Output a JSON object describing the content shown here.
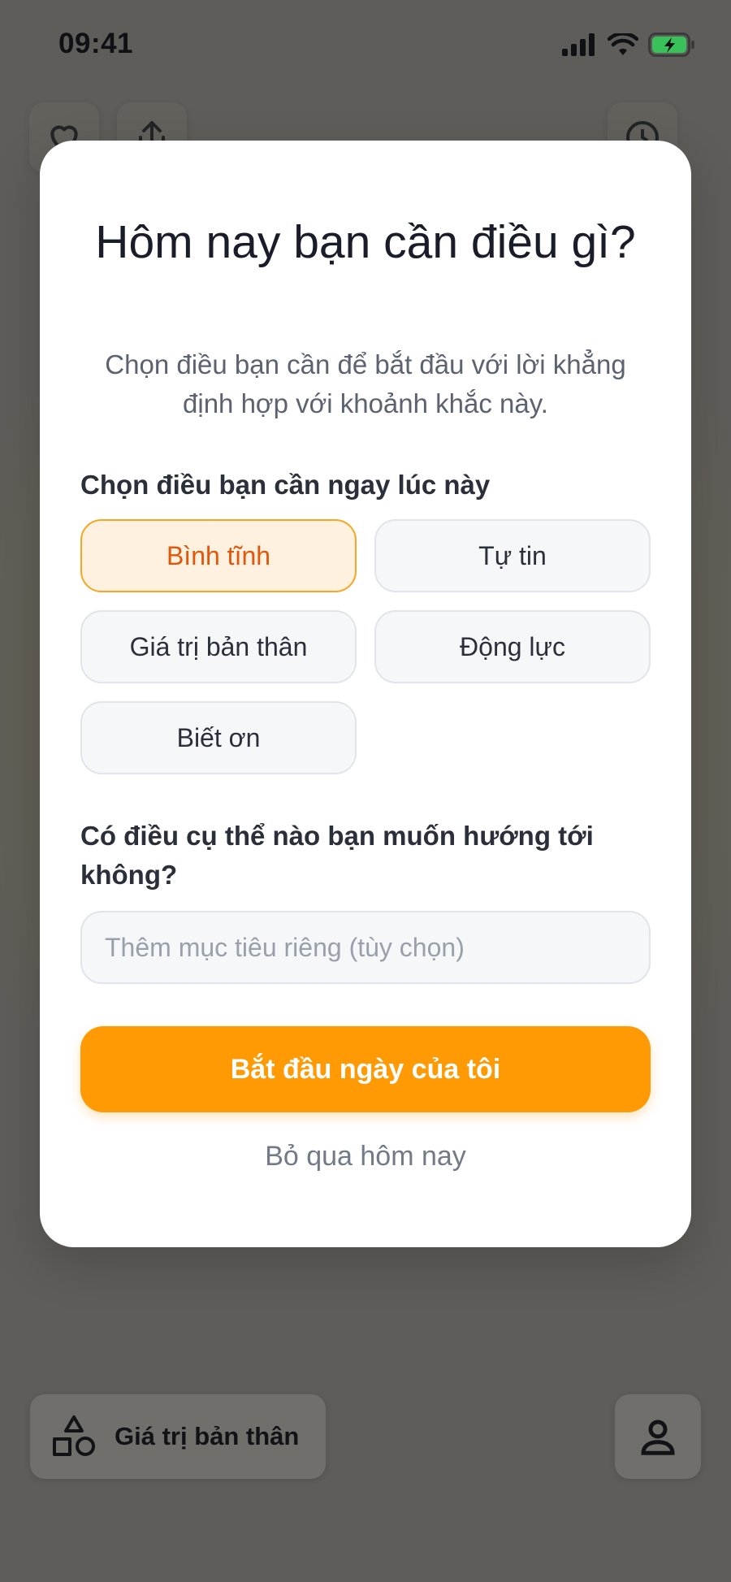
{
  "status_bar": {
    "time": "09:41"
  },
  "modal": {
    "title": "Hôm nay bạn cần điều gì?",
    "subtitle": "Chọn điều bạn cần để bắt đầu với lời khẳng định hợp với khoảnh khắc này.",
    "needs_label": "Chọn điều bạn cần ngay lúc này",
    "options": [
      {
        "label": "Bình tĩnh",
        "selected": true
      },
      {
        "label": "Tự tin",
        "selected": false
      },
      {
        "label": "Giá trị bản thân",
        "selected": false
      },
      {
        "label": "Động lực",
        "selected": false
      },
      {
        "label": "Biết ơn",
        "selected": false
      }
    ],
    "goal_label": "Có điều cụ thể nào bạn muốn hướng tới không?",
    "goal_placeholder": "Thêm mục tiêu riêng (tùy chọn)",
    "goal_value": "",
    "primary_button": "Bắt đầu ngày của tôi",
    "secondary_button": "Bỏ qua hôm nay"
  },
  "bottom_bar": {
    "category_label": "Giá trị bản thân"
  },
  "colors": {
    "accent": "#ff9a05",
    "selected_bg": "#fff1df",
    "selected_text": "#e0560b"
  }
}
